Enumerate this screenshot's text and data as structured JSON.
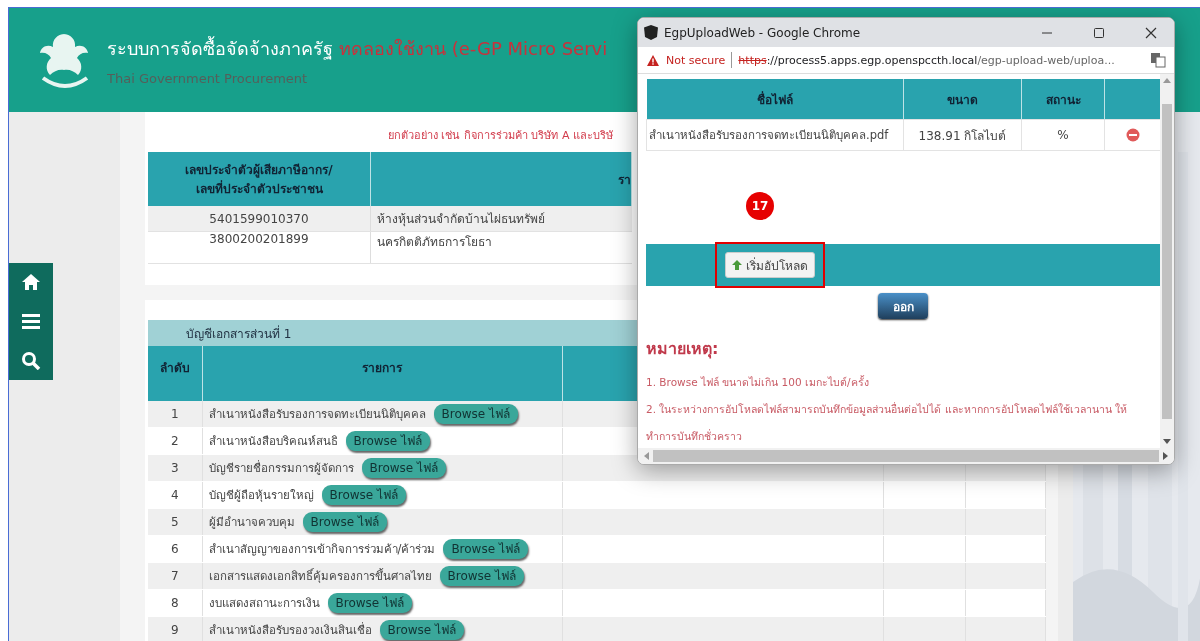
{
  "header": {
    "title": "ระบบการจัดซื้อจัดจ้างภาครัฐ",
    "trial_label": "ทดลองใช้งาน (e-GP Micro Servi",
    "subtitle": "Thai Government Procurement"
  },
  "party_section": {
    "note": "ยกตัวอย่าง เช่น กิจการร่วมค้า บริษัท A และบริษั",
    "columns": [
      "เลขประจำตัวผู้เสียภาษีอากร/\nเลขที่ประจำตัวประชาชน",
      "รา"
    ],
    "rows": [
      {
        "tax_id": "5401599010370",
        "name": "ห้างหุ้นส่วนจำกัดบ้านไผ่ธนทรัพย์"
      },
      {
        "tax_id": "3800200201899",
        "name": "นครกิตติภัทธการโยธา"
      }
    ]
  },
  "document_section": {
    "title": "บัญชีเอกสารส่วนที่ 1",
    "columns": [
      "ลำดับ",
      "รายการ"
    ],
    "rows": [
      {
        "no": "1",
        "item": "สำเนาหนังสือรับรองการจดทะเบียนนิติบุคคล",
        "button": "Browse ไฟล์"
      },
      {
        "no": "2",
        "item": "สำเนาหนังสือบริคณห์สนธิ",
        "button": "Browse ไฟล์"
      },
      {
        "no": "3",
        "item": "บัญชีรายชื่อกรรมการผู้จัดการ",
        "button": "Browse ไฟล์"
      },
      {
        "no": "4",
        "item": "บัญชีผู้ถือหุ้นรายใหญ่",
        "button": "Browse ไฟล์"
      },
      {
        "no": "5",
        "item": "ผู้มีอำนาจควบคุม",
        "button": "Browse ไฟล์"
      },
      {
        "no": "6",
        "item": "สำเนาสัญญาของการเข้ากิจการร่วมค้า/ค้าร่วม",
        "button": "Browse ไฟล์"
      },
      {
        "no": "7",
        "item": "เอกสารแสดงเอกสิทธิ์คุ้มครองการขึ้นศาลไทย",
        "button": "Browse ไฟล์"
      },
      {
        "no": "8",
        "item": "งบแสดงสถานะการเงิน",
        "button": "Browse ไฟล์"
      },
      {
        "no": "9",
        "item": "สำเนาหนังสือรับรองวงเงินสินเชื่อ",
        "button": "Browse ไฟล์"
      }
    ]
  },
  "popup": {
    "title": "EgpUploadWeb - Google Chrome",
    "security": "Not secure",
    "url_scheme": "https",
    "url_host": "://process5.apps.egp.openspccth.local",
    "url_path": "/egp-upload-web/uploa...",
    "file_table": {
      "columns": [
        "ชื่อไฟล์",
        "ขนาด",
        "สถานะ"
      ],
      "rows": [
        {
          "name": "สำเนาหนังสือรับรองการจดทะเบียนนิติบุคคล.pdf",
          "size": "138.91 กิโลไบต์",
          "status": "%"
        }
      ]
    },
    "step_badge": "17",
    "upload_button": "เริ่มอัปโหลด",
    "exit_button": "ออก",
    "notes_title": "หมายเหตุ:",
    "notes": [
      "1. Browse ไฟล์ ขนาดไม่เกิน 100 เมกะไบต์/ครั้ง",
      "2. ในระหว่างการอัปโหลดไฟล์สามารถบันทึกข้อมูลส่วนอื่นต่อไปได้ และหากการอัปโหลดไฟล์ใช้เวลานาน ให้ทำการบันทึกชั่วคราว"
    ]
  }
}
